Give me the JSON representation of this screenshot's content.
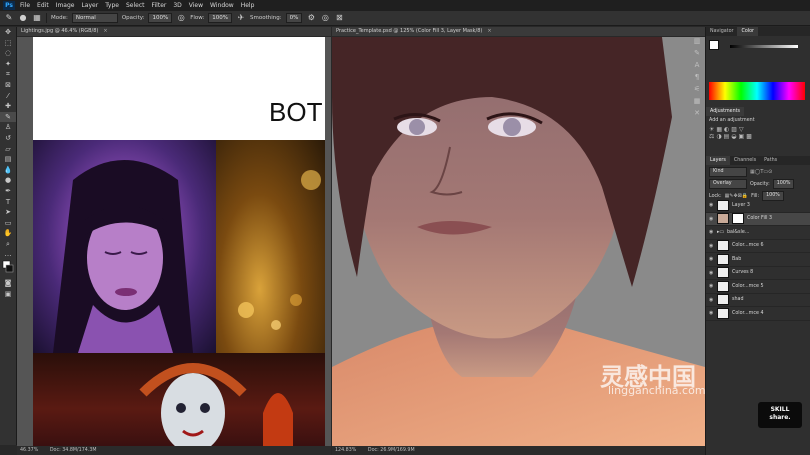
{
  "app": {
    "logo": "Ps"
  },
  "menu": [
    "File",
    "Edit",
    "Image",
    "Layer",
    "Type",
    "Select",
    "Filter",
    "3D",
    "View",
    "Window",
    "Help"
  ],
  "options_bar": {
    "mode_label": "Mode:",
    "mode_value": "Normal",
    "opacity_label": "Opacity:",
    "opacity_value": "100%",
    "flow_label": "Flow:",
    "flow_value": "100%",
    "smoothing_label": "Smoothing:",
    "smoothing_value": "0%"
  },
  "tools": [
    "move-icon",
    "marquee-icon",
    "lasso-icon",
    "quick-select-icon",
    "crop-icon",
    "frame-icon",
    "eyedropper-icon",
    "healing-icon",
    "brush-icon",
    "stamp-icon",
    "history-brush-icon",
    "eraser-icon",
    "gradient-icon",
    "blur-icon",
    "dodge-icon",
    "pen-icon",
    "type-icon",
    "path-select-icon",
    "shape-icon",
    "hand-icon",
    "zoom-icon",
    "more-icon",
    "color-swatch-icon",
    "quick-mask-icon",
    "screen-mode-icon"
  ],
  "left_doc": {
    "tab": "Lightings.jpg @ 46.4% (RGB/8)",
    "zoom": "46.37%",
    "doc": "Doc: 34.8M/174.3M",
    "heading": "BOT"
  },
  "right_doc": {
    "tab": "Practice_Template.psd @ 125% (Color Fill 3, Layer Mask/8)",
    "zoom": "124.83%",
    "doc": "Doc: 26.9M/169.9M"
  },
  "panels": {
    "top_tabs": [
      "Navigator",
      "Color"
    ],
    "adjustments_title": "Adjustments",
    "adjustments_hint": "Add an adjustment",
    "layer_tabs": [
      "Layers",
      "Channels",
      "Paths"
    ],
    "kind": "Kind",
    "blend": "Overlay",
    "opacity_label": "Opacity:",
    "opacity_value": "100%",
    "lock_label": "Lock:",
    "fill_label": "Fill:",
    "fill_value": "100%",
    "layers": [
      "Layer 3",
      "Color Fill 3",
      "bal&sle...",
      "Color...mce 6",
      "Bab",
      "Curves 8",
      "Color...mce 5",
      "shad",
      "Color...mce 4"
    ]
  },
  "watermark": {
    "cn": "灵感中国",
    "en": "lingganchina.com"
  },
  "badge": {
    "line1": "SKILL",
    "line2": "share."
  },
  "colors": {
    "accent": "#31a8ff",
    "panel": "#2f2f2f"
  }
}
